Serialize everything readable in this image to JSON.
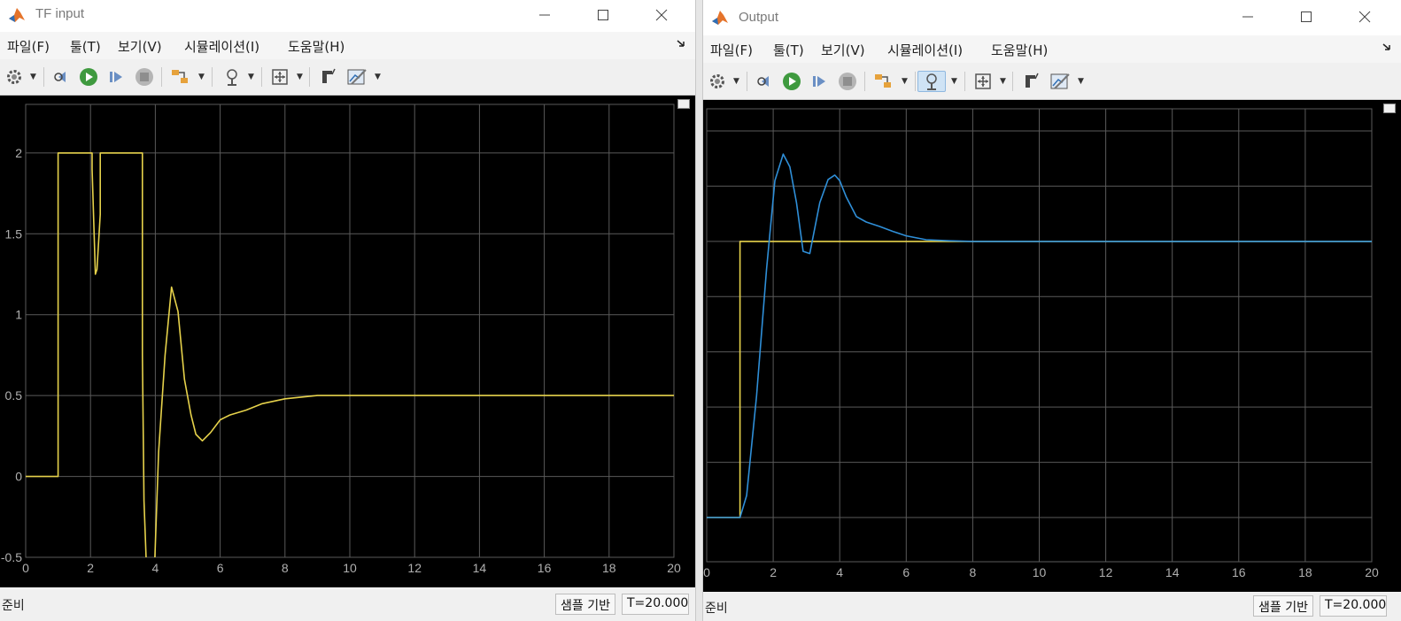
{
  "left_window": {
    "title": "TF input",
    "menu": [
      "파일(F)",
      "툴(T)",
      "보기(V)",
      "시뮬레이션(I)",
      "도움말(H)"
    ],
    "status": {
      "ready": "준비",
      "sample": "샘플 기반",
      "time": "T=20.000"
    }
  },
  "right_window": {
    "title": "Output",
    "menu": [
      "파일(F)",
      "툴(T)",
      "보기(V)",
      "시뮬레이션(I)",
      "도움말(H)"
    ],
    "status": {
      "ready": "준비",
      "sample": "샘플 기반",
      "time": "T=20.000"
    }
  },
  "toolbar_icons": [
    "gear-icon",
    "step-back-icon",
    "run-icon",
    "step-forward-icon",
    "stop-icon",
    "highlight-signal-icon",
    "zoom-icon",
    "fit-to-view-icon",
    "cursor-measure-icon",
    "triggers-icon"
  ],
  "colors": {
    "input_signal": "#E6D24B",
    "output_signal": "#2F8FD8",
    "reference_signal": "#E6D24B",
    "grid": "#5a5a5a",
    "tick_text": "#b0b0b0"
  },
  "chart_data": [
    {
      "type": "line",
      "title": "",
      "xlim": [
        0,
        20
      ],
      "ylim": [
        -0.5,
        2.3
      ],
      "xticks": [
        0,
        2,
        4,
        6,
        8,
        10,
        12,
        14,
        16,
        18,
        20
      ],
      "yticks": [
        -0.5,
        0,
        0.5,
        1,
        1.5,
        2
      ],
      "ytick_labels": [
        "-0.5",
        "0",
        "0.5",
        "1",
        "1.5",
        "2"
      ],
      "grid": true,
      "series": [
        {
          "color": "#E6D24B",
          "x": [
            0,
            1,
            1,
            2.05,
            2.05,
            2.15,
            2.2,
            2.3,
            2.3,
            3.6,
            3.6,
            3.65,
            3.75,
            3.95,
            4.1,
            4.3,
            4.5,
            4.7,
            4.9,
            5.1,
            5.25,
            5.45,
            5.7,
            6.0,
            6.3,
            6.8,
            7.3,
            8.0,
            9.0,
            10.0,
            12.0,
            15.0,
            20.0
          ],
          "y": [
            0,
            0,
            2,
            2,
            1.9,
            1.25,
            1.28,
            1.62,
            2,
            2,
            0.75,
            -0.15,
            -0.7,
            -0.7,
            0.15,
            0.75,
            1.17,
            1.02,
            0.6,
            0.38,
            0.26,
            0.22,
            0.27,
            0.35,
            0.38,
            0.41,
            0.45,
            0.48,
            0.5,
            0.5,
            0.5,
            0.5,
            0.5
          ]
        }
      ]
    },
    {
      "type": "line",
      "title": "",
      "xlim": [
        0,
        20
      ],
      "ylim": [
        -0.8,
        7.4
      ],
      "xticks": [
        0,
        2,
        4,
        6,
        8,
        10,
        12,
        14,
        16,
        18,
        20
      ],
      "yticks": [
        0,
        1,
        2,
        3,
        4,
        5,
        6,
        7
      ],
      "grid": true,
      "series": [
        {
          "color": "#E6D24B",
          "x": [
            0,
            1,
            1,
            20
          ],
          "y": [
            0,
            0,
            5,
            5
          ]
        },
        {
          "color": "#2F8FD8",
          "x": [
            0,
            1.0,
            1.2,
            1.5,
            1.8,
            2.05,
            2.3,
            2.5,
            2.7,
            2.9,
            3.1,
            3.4,
            3.65,
            3.85,
            4.0,
            4.2,
            4.5,
            4.8,
            5.2,
            5.6,
            6.0,
            6.6,
            7.3,
            8.0,
            10.0,
            20.0
          ],
          "y": [
            0,
            0,
            0.4,
            2.2,
            4.5,
            6.1,
            6.58,
            6.35,
            5.7,
            4.82,
            4.78,
            5.7,
            6.12,
            6.2,
            6.1,
            5.8,
            5.45,
            5.35,
            5.27,
            5.18,
            5.1,
            5.03,
            5.01,
            5.0,
            5.0,
            5.0
          ]
        }
      ]
    }
  ]
}
